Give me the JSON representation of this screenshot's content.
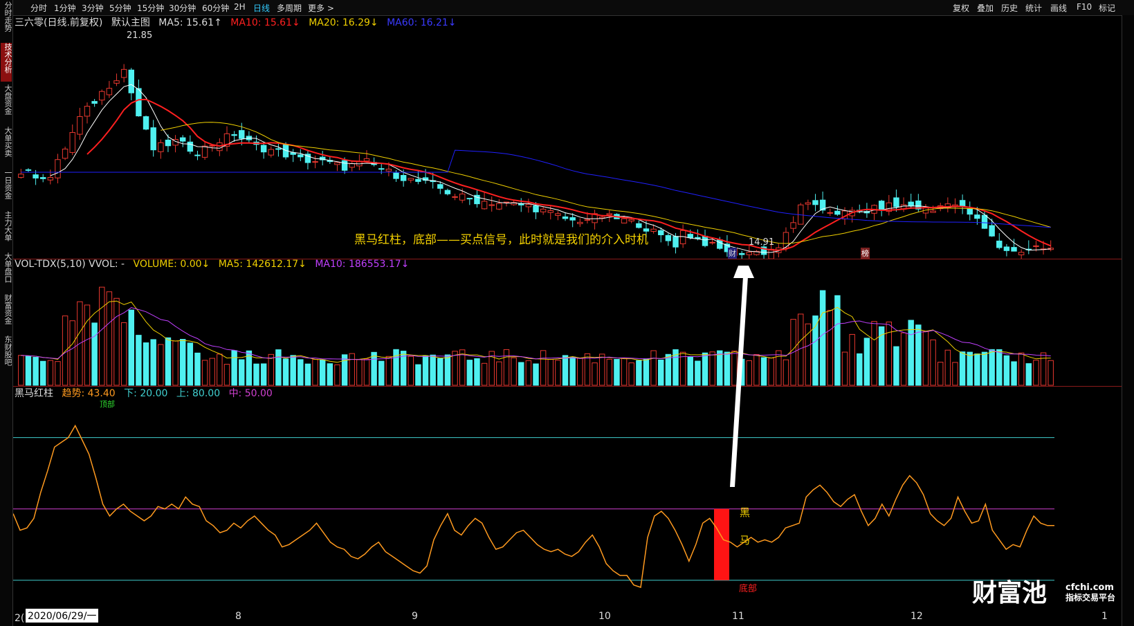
{
  "toolbar": {
    "periods": [
      "分时",
      "1分钟",
      "3分钟",
      "5分钟",
      "15分钟",
      "30分钟",
      "60分钟",
      "2H",
      "日线",
      "多周期",
      "更多 >"
    ],
    "active_period": "日线",
    "right_buttons": [
      "复权",
      "叠加",
      "历史",
      "统计",
      "画线",
      "F10",
      "标记"
    ]
  },
  "sidebar": {
    "items": [
      "分时走势",
      "技术分析",
      "大盘资金",
      "大单买卖",
      "一日资金",
      "主力大单",
      "大单盘口",
      "财富资金",
      "东财股吧"
    ],
    "active": "技术分析"
  },
  "main_legend": {
    "stock": "三六零(日线.前复权)",
    "template": "默认主图",
    "ma5": "MA5: 15.61↑",
    "ma10": "MA10: 15.61↓",
    "ma20": "MA20: 16.29↓",
    "ma60": "MA60: 16.21↓"
  },
  "vol_legend": {
    "name": "VOL-TDX(5,10) VVOL: -",
    "volume": "VOLUME: 0.00↓",
    "ma5": "MA5: 142612.17↓",
    "ma10": "MA10: 186553.17↓"
  },
  "ind_legend": {
    "name": "黑马红柱",
    "trend": "趋势: 43.40",
    "lower": "下: 20.00",
    "upper": "上: 80.00",
    "mid": "中: 50.00"
  },
  "price_high": "21.85",
  "price_low": "14.91",
  "tag_cai": "财",
  "tag_bang": "榜",
  "annotation": "黑马红柱，底部——买点信号，此时就是我们的介入时机",
  "heima": {
    "char1": "黑",
    "char2": "马",
    "bottom": "底部",
    "top": "顶部"
  },
  "x_axis": [
    "8",
    "9",
    "10",
    "11",
    "12",
    "1"
  ],
  "date_tag": "2020/06/29/一",
  "date_prefix": "2(",
  "logo": {
    "main": "财富池",
    "domain": "cfchi.com",
    "sub": "指标交易平台"
  },
  "colors": {
    "up": "#e8382f",
    "down": "#4ff0f0",
    "ma5": "#ffffff",
    "ma10": "#ff2020",
    "ma20": "#f0d000",
    "ma60": "#2020ff",
    "vol_ma10": "#c040ff",
    "trend": "#ff9a1f",
    "band": "#40d0d0",
    "mid": "#d040d0"
  },
  "chart_data": {
    "type": "candlestick",
    "ylim": [
      14.0,
      22.5
    ],
    "trend_line": [
      48,
      41,
      42,
      46,
      57,
      66,
      76,
      78,
      80,
      85,
      79,
      73,
      63,
      52,
      47,
      50,
      52,
      49,
      47,
      45,
      47,
      51,
      50,
      52,
      50,
      55,
      52,
      51,
      45,
      43,
      40,
      41,
      44,
      42,
      45,
      47,
      44,
      41,
      39,
      34,
      35,
      37,
      39,
      41,
      44,
      40,
      36,
      34,
      33,
      30,
      29,
      31,
      34,
      36,
      32,
      30,
      28,
      26,
      24,
      23,
      26,
      37,
      43,
      48,
      41,
      39,
      43,
      46,
      44,
      38,
      33,
      34,
      37,
      40,
      41,
      38,
      35,
      33,
      32,
      33,
      31,
      30,
      32,
      36,
      39,
      34,
      27,
      24,
      22,
      22,
      18,
      17,
      38,
      47,
      49,
      46,
      41,
      35,
      28,
      35,
      44,
      46,
      42,
      37,
      36,
      34,
      36,
      38,
      36,
      37,
      36,
      38,
      42,
      43,
      44,
      55,
      58,
      60,
      57,
      53,
      51,
      54,
      56,
      49,
      43,
      46,
      52,
      47,
      54,
      60,
      64,
      61,
      56,
      48,
      45,
      43,
      46,
      55,
      49,
      44,
      45,
      52,
      41,
      37,
      33,
      35,
      34,
      41,
      47,
      44,
      43,
      43
    ]
  }
}
